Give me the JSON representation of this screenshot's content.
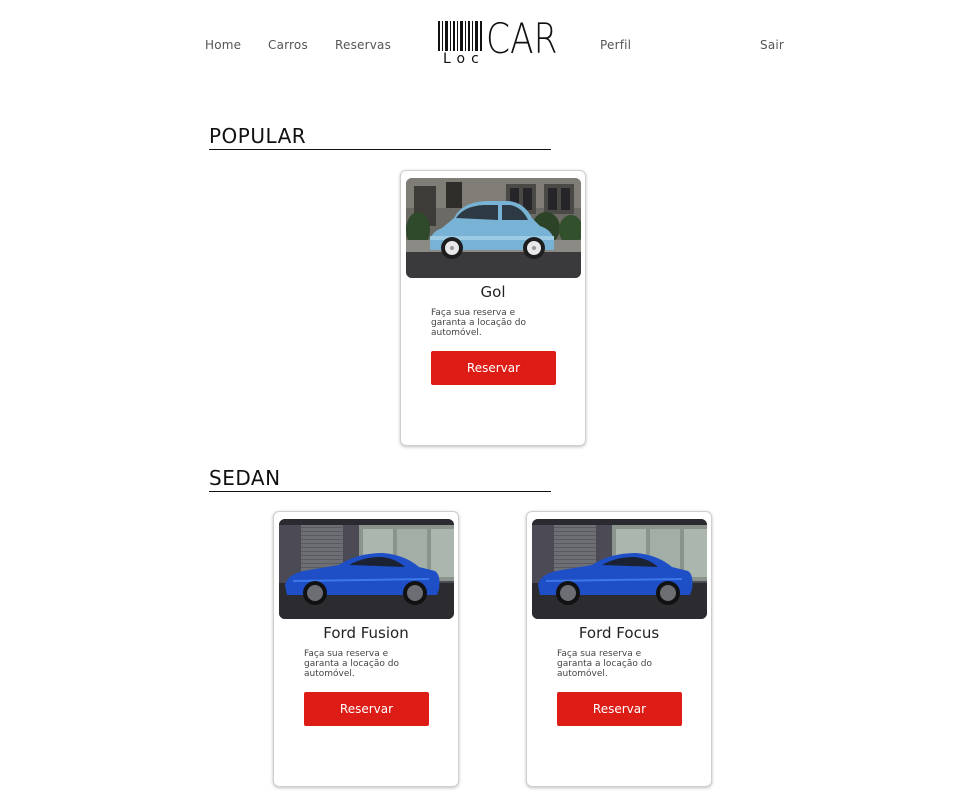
{
  "nav": {
    "home": "Home",
    "carros": "Carros",
    "reservas": "Reservas",
    "perfil": "Perfil",
    "sair": "Sair"
  },
  "logo": {
    "car": "CAR",
    "loc": "Loc"
  },
  "sections": {
    "popular": {
      "title": "POPULAR",
      "cards": [
        {
          "title": "Gol",
          "description": "Faça sua reserva e garanta a locação do automóvel.",
          "button": "Reservar",
          "image": "light-blue-compact-car-photo"
        }
      ]
    },
    "sedan": {
      "title": "SEDAN",
      "cards": [
        {
          "title": "Ford Fusion",
          "description": "Faça sua reserva e garanta a locação do automóvel.",
          "button": "Reservar",
          "image": "blue-coupe-car-photo"
        },
        {
          "title": "Ford Focus",
          "description": "Faça sua reserva e garanta a locação do automóvel.",
          "button": "Reservar",
          "image": "blue-coupe-car-photo"
        }
      ]
    }
  },
  "colors": {
    "button": "#dd1c16",
    "button_text": "#ffffff",
    "text": "#333333"
  }
}
